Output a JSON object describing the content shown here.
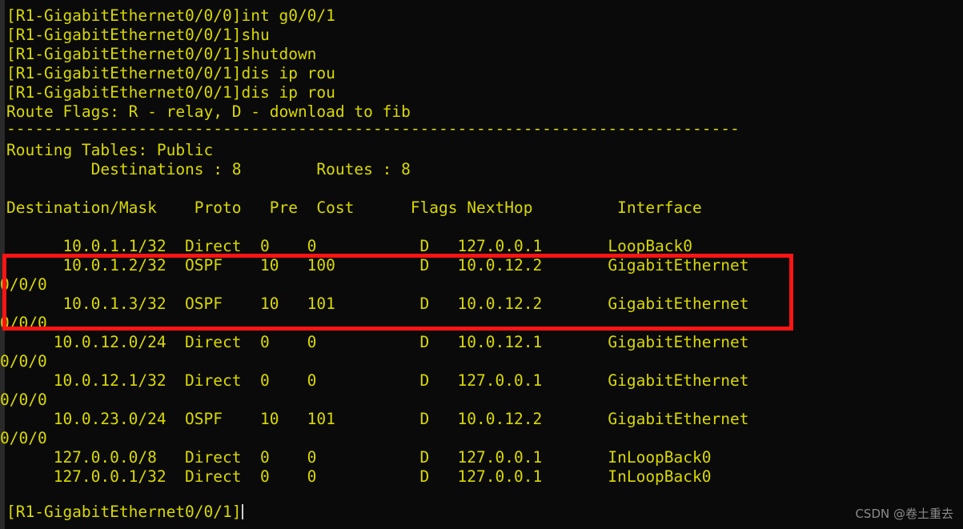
{
  "terminal": {
    "background_color": "#0a0a0a",
    "text_color": "#d9d900",
    "annotation_color": "#ff1414",
    "console_lines": [
      "[R1-GigabitEthernet0/0/0]int g0/0/1",
      "[R1-GigabitEthernet0/0/1]shu",
      "[R1-GigabitEthernet0/0/1]shutdown",
      "[R1-GigabitEthernet0/0/1]dis ip rou",
      "[R1-GigabitEthernet0/0/1]dis ip rou"
    ],
    "route_flags_line": "Route Flags: R - relay, D - download to fib",
    "separator_line": "------------------------------------------------------------------------------",
    "routing_table_title": "Routing Tables: Public",
    "summary_line": "         Destinations : 8        Routes : 8",
    "column_header_line": "Destination/Mask    Proto   Pre  Cost      Flags NextHop         Interface",
    "rows": [
      {
        "main": "      10.0.1.1/32  Direct  0    0           D   127.0.0.1       LoopBack0",
        "cont": null,
        "destination": "10.0.1.1/32",
        "proto": "Direct",
        "pre": "0",
        "cost": "0",
        "flags": "D",
        "nexthop": "127.0.0.1",
        "interface": "LoopBack0",
        "highlighted": false
      },
      {
        "main": "      10.0.1.2/32  OSPF    10   100         D   10.0.12.2       GigabitEthernet",
        "cont": "0/0/0",
        "destination": "10.0.1.2/32",
        "proto": "OSPF",
        "pre": "10",
        "cost": "100",
        "flags": "D",
        "nexthop": "10.0.12.2",
        "interface": "GigabitEthernet0/0/0",
        "highlighted": true
      },
      {
        "main": "      10.0.1.3/32  OSPF    10   101         D   10.0.12.2       GigabitEthernet",
        "cont": "0/0/0",
        "destination": "10.0.1.3/32",
        "proto": "OSPF",
        "pre": "10",
        "cost": "101",
        "flags": "D",
        "nexthop": "10.0.12.2",
        "interface": "GigabitEthernet0/0/0",
        "highlighted": true
      },
      {
        "main": "     10.0.12.0/24  Direct  0    0           D   10.0.12.1       GigabitEthernet",
        "cont": "0/0/0",
        "destination": "10.0.12.0/24",
        "proto": "Direct",
        "pre": "0",
        "cost": "0",
        "flags": "D",
        "nexthop": "10.0.12.1",
        "interface": "GigabitEthernet0/0/0",
        "highlighted": false
      },
      {
        "main": "     10.0.12.1/32  Direct  0    0           D   127.0.0.1       GigabitEthernet",
        "cont": "0/0/0",
        "destination": "10.0.12.1/32",
        "proto": "Direct",
        "pre": "0",
        "cost": "0",
        "flags": "D",
        "nexthop": "127.0.0.1",
        "interface": "GigabitEthernet0/0/0",
        "highlighted": false
      },
      {
        "main": "     10.0.23.0/24  OSPF    10   101         D   10.0.12.2       GigabitEthernet",
        "cont": "0/0/0",
        "destination": "10.0.23.0/24",
        "proto": "OSPF",
        "pre": "10",
        "cost": "101",
        "flags": "D",
        "nexthop": "10.0.12.2",
        "interface": "GigabitEthernet0/0/0",
        "highlighted": false
      },
      {
        "main": "     127.0.0.0/8   Direct  0    0           D   127.0.0.1       InLoopBack0",
        "cont": null,
        "destination": "127.0.0.0/8",
        "proto": "Direct",
        "pre": "0",
        "cost": "0",
        "flags": "D",
        "nexthop": "127.0.0.1",
        "interface": "InLoopBack0",
        "highlighted": false
      },
      {
        "main": "     127.0.0.1/32  Direct  0    0           D   127.0.0.1       InLoopBack0",
        "cont": null,
        "destination": "127.0.0.1/32",
        "proto": "Direct",
        "pre": "0",
        "cost": "0",
        "flags": "D",
        "nexthop": "127.0.0.1",
        "interface": "InLoopBack0",
        "highlighted": false
      }
    ],
    "prompt_line": "[R1-GigabitEthernet0/0/1]"
  },
  "watermark": {
    "text": "CSDN @卷土重去"
  }
}
